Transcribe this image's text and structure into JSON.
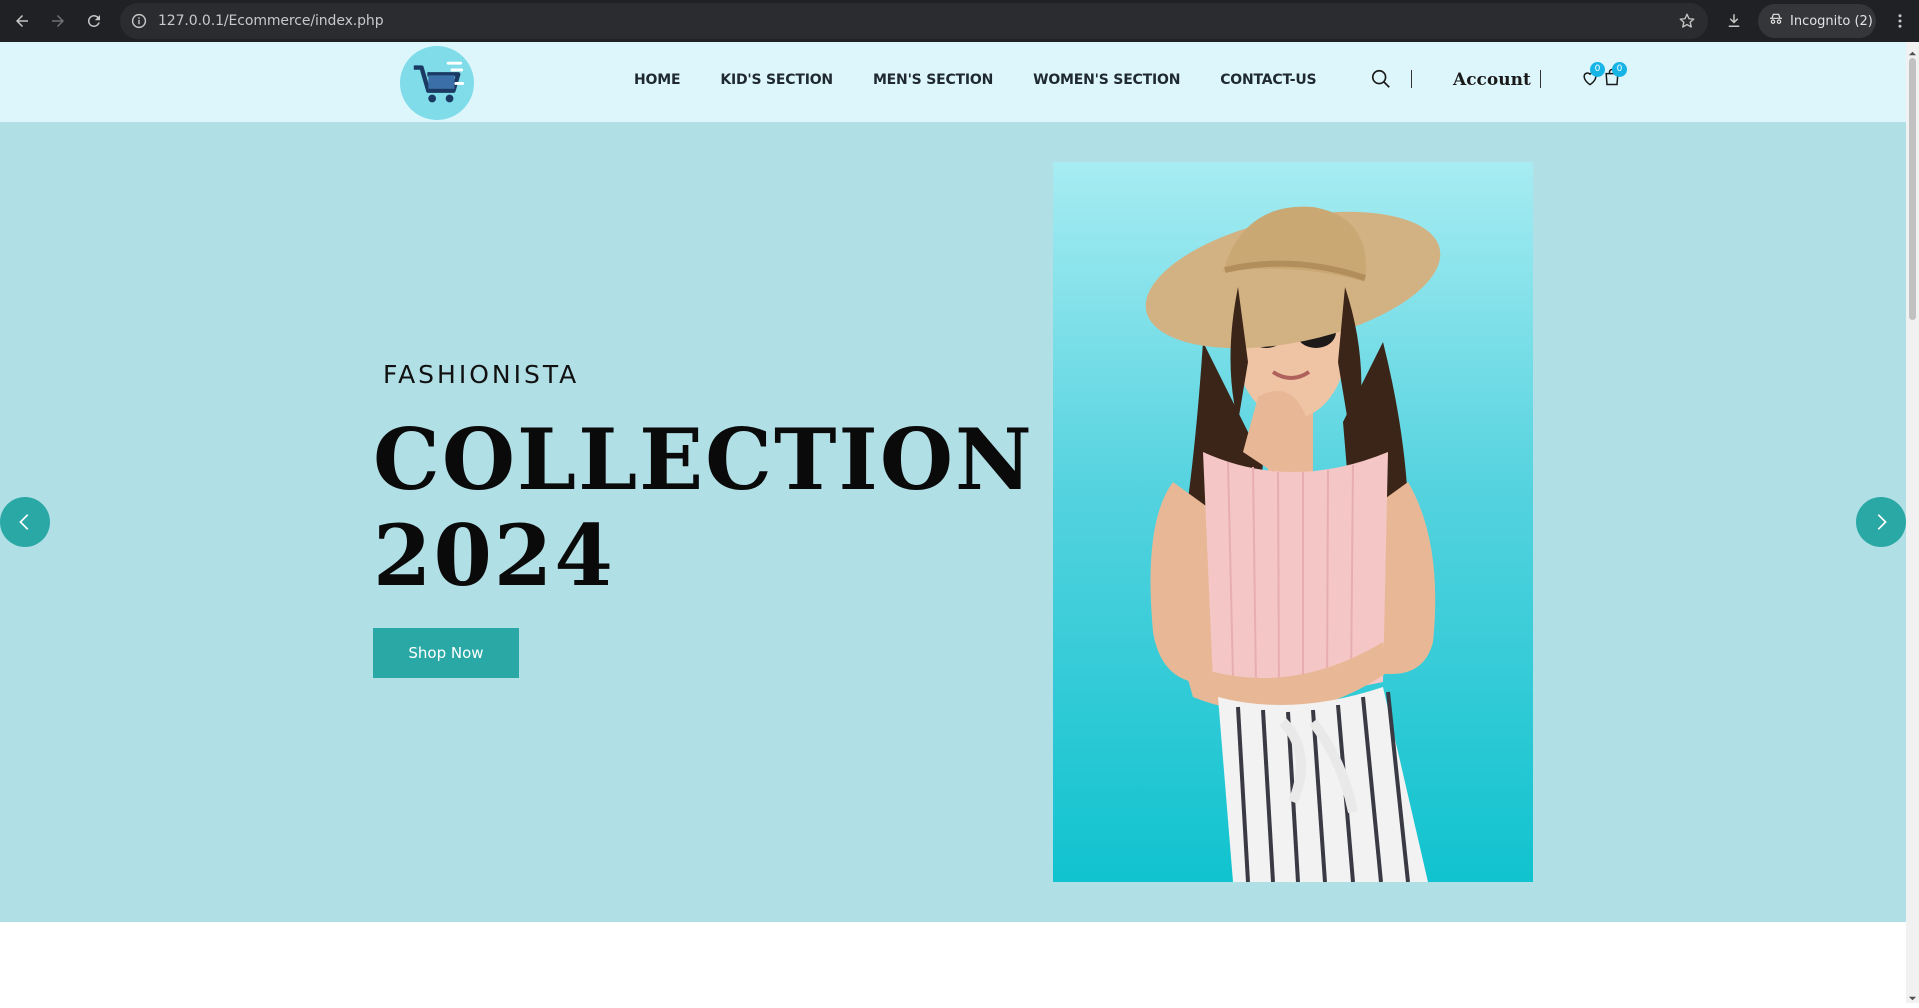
{
  "browser": {
    "url": "127.0.0.1/Ecommerce/index.php",
    "incognito_label": "Incognito (2)",
    "icons": [
      "back-icon",
      "forward-icon",
      "reload-icon",
      "site-info-icon",
      "bookmark-star-icon",
      "download-icon",
      "incognito-icon",
      "menu-kebab-icon"
    ]
  },
  "header": {
    "logo_icon": "shopping-cart-icon",
    "nav": [
      "HOME",
      "KID'S SECTION",
      "MEN'S SECTION",
      "WOMEN'S SECTION",
      "CONTACT-US"
    ],
    "account_label": "Account",
    "wishlist_count": "0",
    "cart_count": "0"
  },
  "hero": {
    "eyebrow": "FASHIONISTA",
    "title_line1": "COLLECTION",
    "title_line2": "2024",
    "cta_label": "Shop Now",
    "prev_icon": "chevron-left-icon",
    "next_icon": "chevron-right-icon"
  },
  "colors": {
    "header_bg": "#ddf6fc",
    "hero_bg": "#b0dfe5",
    "accent": "#2aa8a6",
    "badge": "#17b5e6"
  }
}
